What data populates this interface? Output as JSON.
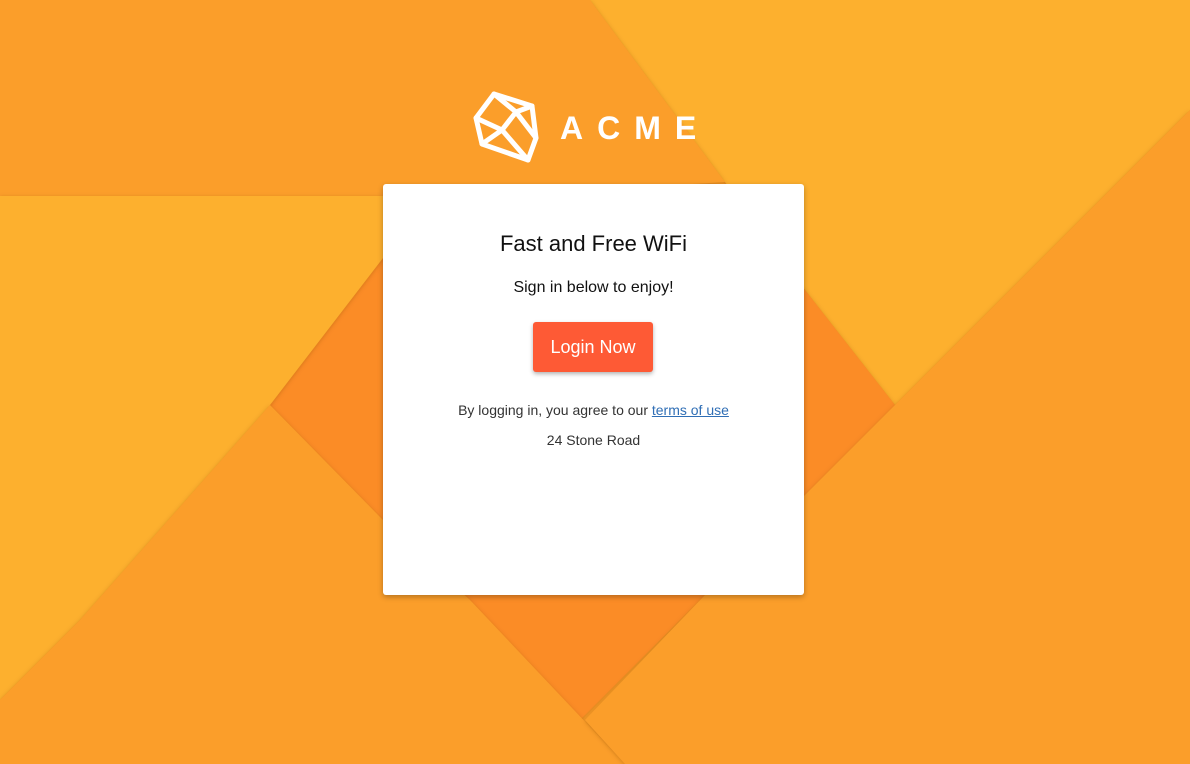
{
  "brand": {
    "name": "ACME",
    "icon": "cube-icon"
  },
  "card": {
    "title": "Fast and Free WiFi",
    "subtitle": "Sign in below to enjoy!",
    "login_button_label": "Login Now",
    "terms_prefix": "By logging in, you agree to our ",
    "terms_link_label": "terms of use",
    "address": "24 Stone Road"
  },
  "colors": {
    "background_orange": "#fb9e2a",
    "button_red_orange": "#fe5a35",
    "link_blue": "#2f6eb5"
  }
}
